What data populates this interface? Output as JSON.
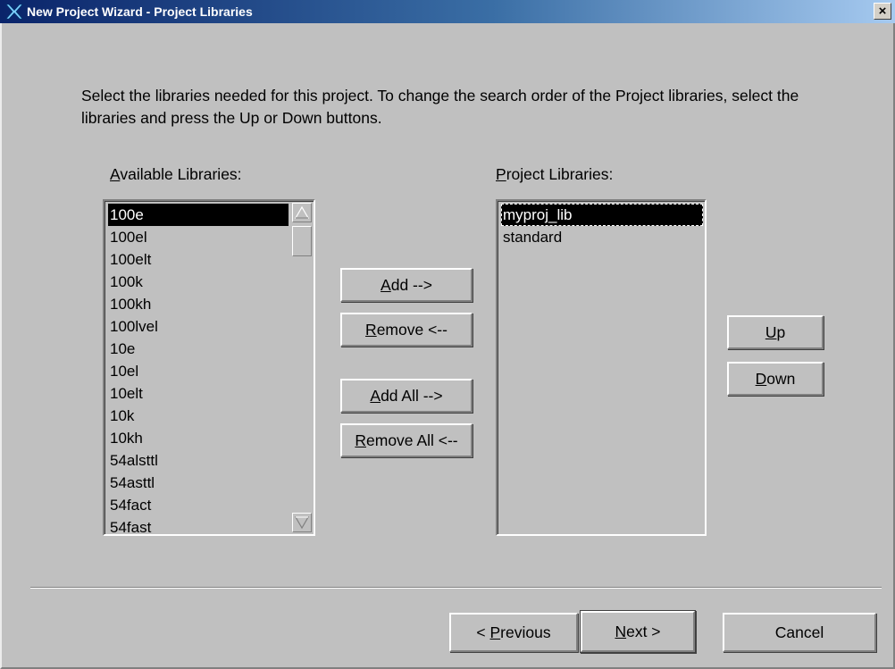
{
  "window": {
    "title": "New Project Wizard - Project Libraries",
    "close_label": "×"
  },
  "instructions": "Select the libraries needed for this project. To change the search order of the Project libraries, select the libraries and press the Up or Down buttons.",
  "available": {
    "label_mnemonic": "A",
    "label_rest": "vailable Libraries:",
    "items": [
      "100e",
      "100el",
      "100elt",
      "100k",
      "100kh",
      "100lvel",
      "10e",
      "10el",
      "10elt",
      "10k",
      "10kh",
      "54alsttl",
      "54asttl",
      "54fact",
      "54fast"
    ],
    "selected_index": 0
  },
  "project": {
    "label_mnemonic": "P",
    "label_rest": "roject Libraries:",
    "items": [
      "myproj_lib",
      "standard"
    ],
    "selected_index": 0
  },
  "buttons": {
    "add": {
      "mn": "A",
      "rest": "dd -->"
    },
    "remove": {
      "mn": "R",
      "rest": "emove <--"
    },
    "add_all": {
      "mn": "A",
      "rest": "dd All -->"
    },
    "remove_all": {
      "mn": "R",
      "rest": "emove All <--"
    },
    "up": {
      "mn": "U",
      "rest": "p"
    },
    "down": {
      "mn": "D",
      "rest": "own"
    },
    "previous": {
      "pre": "< ",
      "mn": "P",
      "rest": "revious"
    },
    "next": {
      "mn": "N",
      "rest": "ext >"
    },
    "cancel": "Cancel"
  },
  "colors": {
    "face": "#c0c0c0",
    "title_start": "#0a246a",
    "title_end": "#a6caf0",
    "selection": "#000000"
  },
  "icons": {
    "app": "xilinx-logo-icon",
    "close": "close-icon"
  }
}
